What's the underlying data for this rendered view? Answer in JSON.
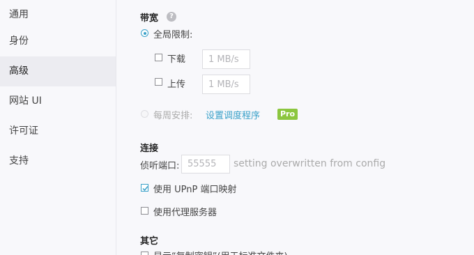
{
  "sidebar": {
    "items": [
      {
        "label": "通用",
        "active": false
      },
      {
        "label": "身份",
        "active": false
      },
      {
        "label": "高级",
        "active": true
      },
      {
        "label": "网站 UI",
        "active": false
      },
      {
        "label": "许可证",
        "active": false
      },
      {
        "label": "支持",
        "active": false
      }
    ]
  },
  "bandwidth": {
    "title": "带宽",
    "help_icon": "question-mark-icon",
    "global_limit_label": "全局限制:",
    "download_label": "下载",
    "download_placeholder": "1 MB/s",
    "upload_label": "上传",
    "upload_placeholder": "1 MB/s",
    "weekly_schedule_label": "每周安排:",
    "schedule_link": "设置调度程序",
    "pro_badge": "Pro"
  },
  "connection": {
    "title": "连接",
    "listen_port_label": "侦听端口:",
    "listen_port_placeholder": "55555",
    "port_note": "setting overwritten from config",
    "upnp_label": "使用 UPnP 端口映射",
    "upnp_checked": true,
    "proxy_label": "使用代理服务器",
    "proxy_checked": false
  },
  "other": {
    "title": "其它",
    "cut_item_label": "显示“复制密钥”(用于标准文件夹)"
  },
  "colors": {
    "accent": "#3aa1c9",
    "pro_badge": "#8cc63f"
  }
}
